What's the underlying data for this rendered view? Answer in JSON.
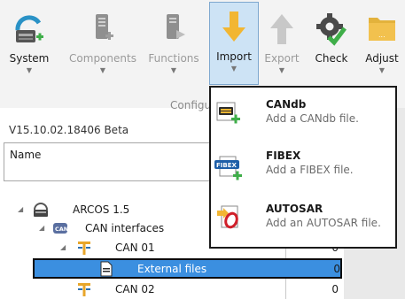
{
  "ribbon": {
    "buttons": [
      {
        "label": "System",
        "icon": "system-icon",
        "enabled": true,
        "has_arrow": true
      },
      {
        "label": "Components",
        "icon": "components-icon",
        "enabled": false,
        "has_arrow": true
      },
      {
        "label": "Functions",
        "icon": "functions-icon",
        "enabled": false,
        "has_arrow": true
      },
      {
        "label": "Import",
        "icon": "import-arrow-icon",
        "enabled": true,
        "has_arrow": true,
        "active": true
      },
      {
        "label": "Export",
        "icon": "export-arrow-icon",
        "enabled": false,
        "has_arrow": true
      },
      {
        "label": "Check",
        "icon": "check-gear-icon",
        "enabled": true,
        "has_arrow": false
      },
      {
        "label": "Adjust",
        "icon": "adjust-folder-icon",
        "enabled": true,
        "has_arrow": true
      }
    ],
    "group_label": "Configu"
  },
  "import_menu": {
    "items": [
      {
        "title": "CANdb",
        "description": "Add a CANdb file.",
        "icon": "candb-file-icon"
      },
      {
        "title": "FIBEX",
        "description": "Add a FIBEX file.",
        "icon": "fibex-file-icon",
        "badge": "FIBEX"
      },
      {
        "title": "AUTOSAR",
        "description": "Add an AUTOSAR file.",
        "icon": "autosar-file-icon"
      }
    ]
  },
  "panel": {
    "version": "V15.10.02.18406 Beta",
    "name_header": "Name"
  },
  "tree": [
    {
      "label": "ARCOS 1.5",
      "icon": "ecu-system-icon",
      "expanded": true,
      "value": ""
    },
    {
      "label": "CAN interfaces",
      "icon": "can-interface-icon",
      "badge": "CAN",
      "expanded": true,
      "value": ""
    },
    {
      "label": "CAN 01",
      "icon": "can-bus-icon",
      "expanded": true,
      "value": "0"
    },
    {
      "label": "External files",
      "icon": "external-file-icon",
      "selected": true,
      "value": "0"
    },
    {
      "label": "CAN 02",
      "icon": "can-bus-icon",
      "value": "0"
    }
  ],
  "colors": {
    "ribbon_bg": "#f3f3f3",
    "active_button_bg": "#cde3f5",
    "selection_bg": "#3b8fe0",
    "import_arrow": "#f2b632",
    "check_green": "#3fae49"
  }
}
